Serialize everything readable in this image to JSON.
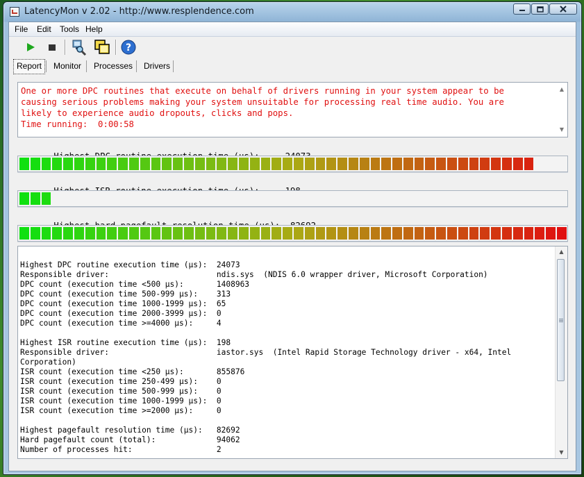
{
  "window": {
    "title": "LatencyMon v 2.02 - http://www.resplendence.com"
  },
  "menu": [
    {
      "label": "File"
    },
    {
      "label": "Edit"
    },
    {
      "label": "Tools"
    },
    {
      "label": "Help"
    }
  ],
  "tabs": [
    {
      "label": "Report"
    },
    {
      "label": "Monitor"
    },
    {
      "label": "Processes"
    },
    {
      "label": "Drivers"
    }
  ],
  "message": {
    "text": "One or more DPC routines that execute on behalf of drivers running in your system appear to be\ncausing serious problems making your system unsuitable for processing real time audio. You are\nlikely to experience audio dropouts, clicks and pops.\nTime running:  0:00:58"
  },
  "metrics": {
    "dpc": {
      "label": "Highest DPC routine execution time (µs):",
      "value": "24073",
      "level": 0.945
    },
    "isr": {
      "label": "Highest ISR routine execution time (µs):",
      "value": "198",
      "level": 0.056
    },
    "pagefault": {
      "label": "Highest hard pagefault resolution time (µs):",
      "value": "82692",
      "level": 1.0
    }
  },
  "report": {
    "text": "Highest DPC routine execution time (µs):  24073\nResponsible driver:                       ndis.sys  (NDIS 6.0 wrapper driver, Microsoft Corporation)\nDPC count (execution time <500 µs):       1408963\nDPC count (execution time 500-999 µs):    313\nDPC count (execution time 1000-1999 µs):  65\nDPC count (execution time 2000-3999 µs):  0\nDPC count (execution time >=4000 µs):     4\n\nHighest ISR routine execution time (µs):  198\nResponsible driver:                       iastor.sys  (Intel Rapid Storage Technology driver - x64, Intel\nCorporation)\nISR count (execution time <250 µs):       855876\nISR count (execution time 250-499 µs):    0\nISR count (execution time 500-999 µs):    0\nISR count (execution time 1000-1999 µs):  0\nISR count (execution time >=2000 µs):     0\n\nHighest pagefault resolution time (µs):   82692\nHard pagefault count (total):             94062\nNumber of processes hit:                  2"
  },
  "colors": {
    "alert_text": "#e01010",
    "bar_start": "#10e010",
    "bar_end": "#e01010"
  }
}
